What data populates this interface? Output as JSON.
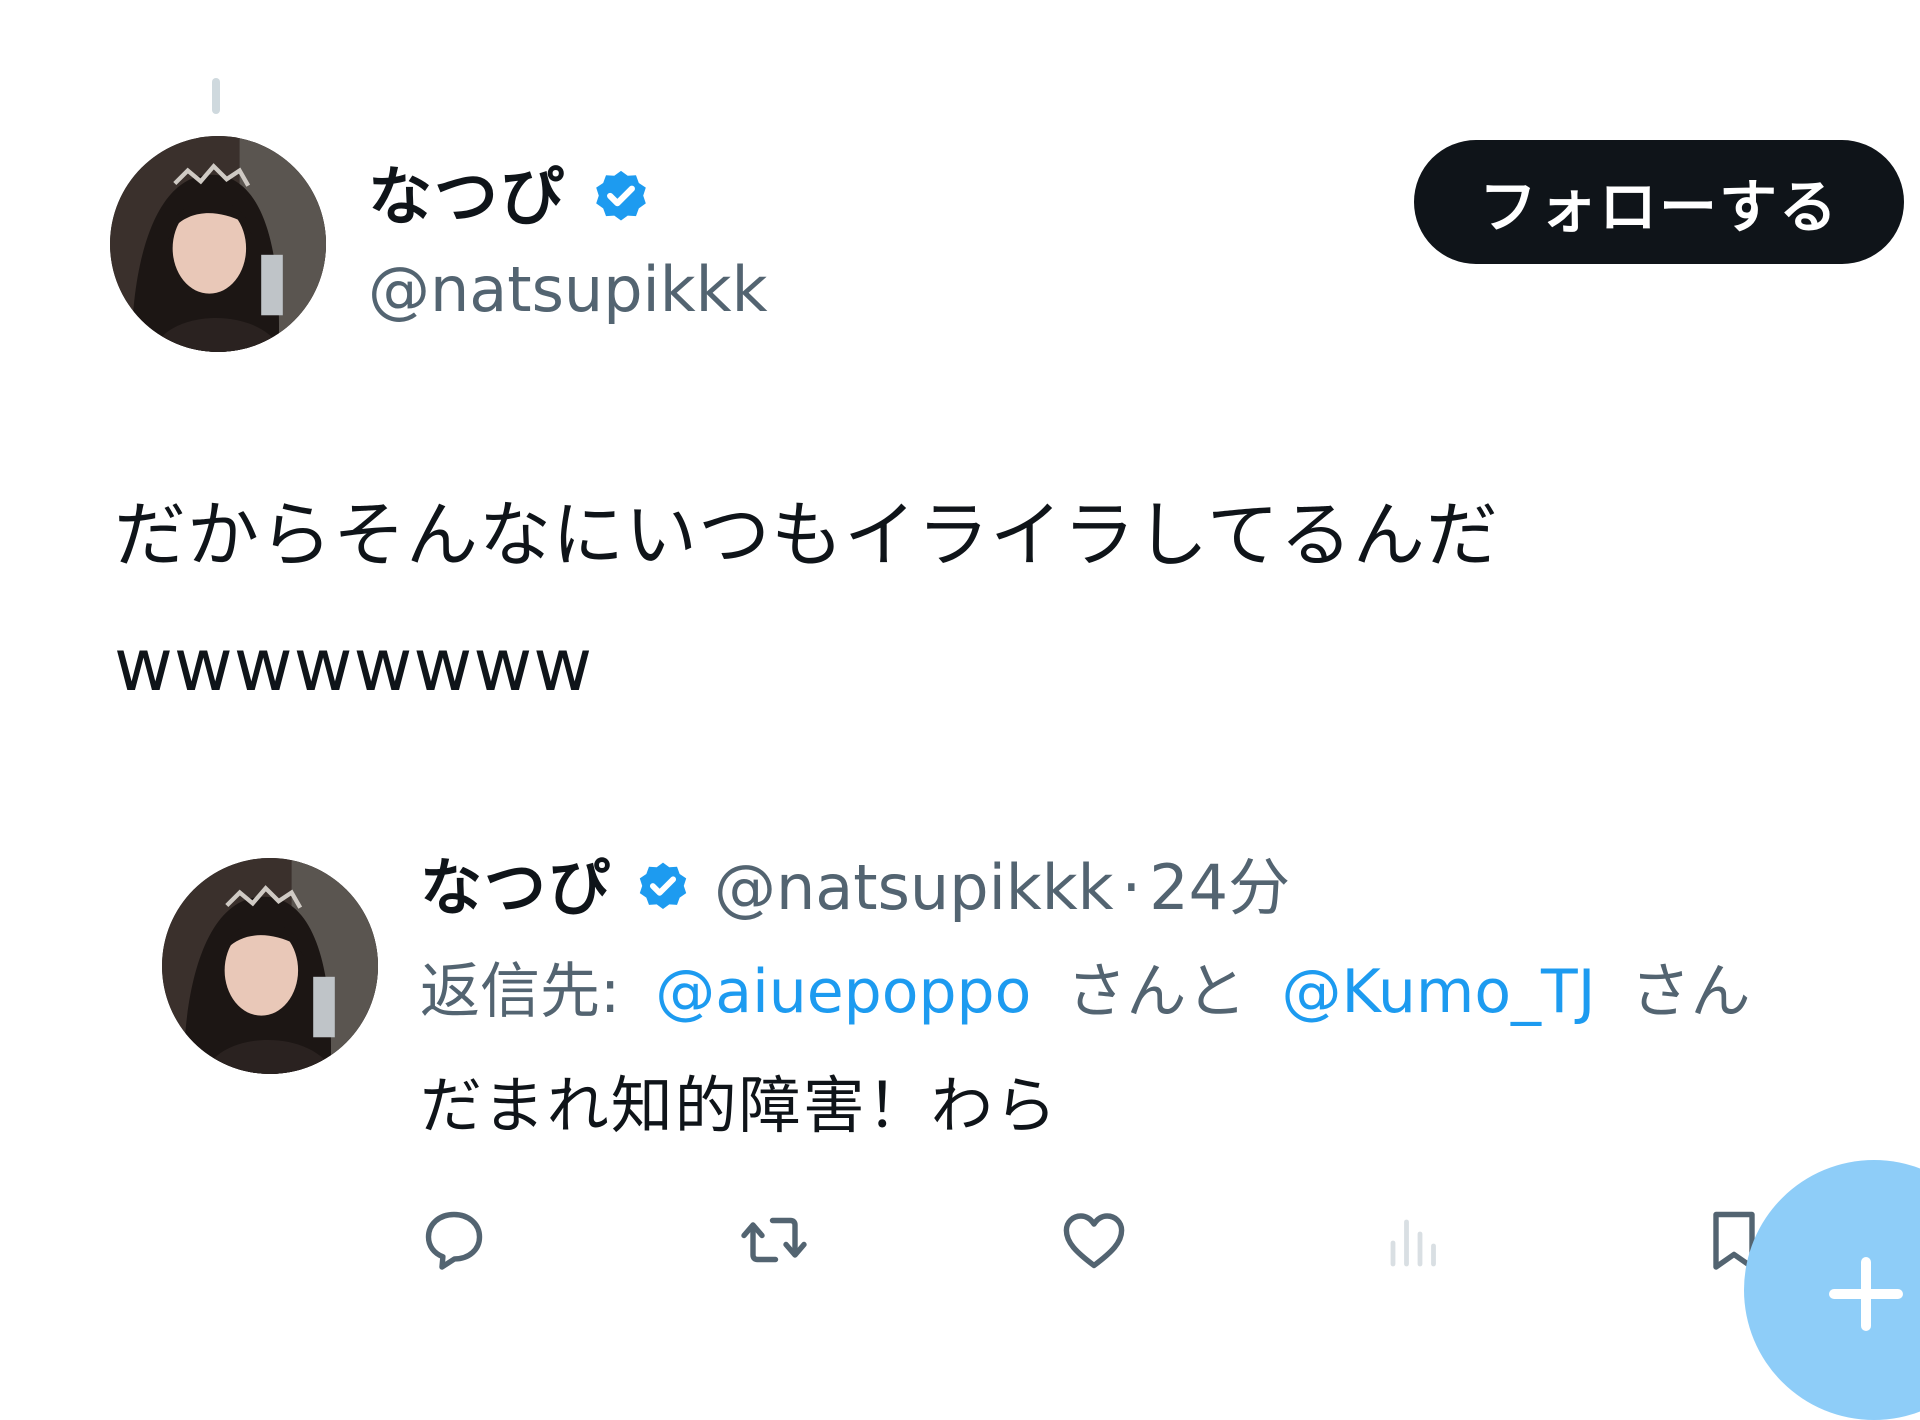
{
  "colors": {
    "accent": "#1d9bf0",
    "text": "#0f1419",
    "secondary": "#536471",
    "follow_button_bg": "#0f1419",
    "fab": "#8ecdf8"
  },
  "tweet": {
    "display_name": "なつぴ",
    "handle": "@natsupikkk",
    "verified_icon": "verified-badge-icon",
    "follow_button_label": "フォローする",
    "text_line1": "だからそんなにいつもイライラしてるんだ",
    "text_line2": "wwwwwwww"
  },
  "reply": {
    "display_name": "なつぴ",
    "handle": "@natsupikkk",
    "separator": "·",
    "time": "24分",
    "replying_to_label": "返信先:",
    "mention_1": "@aiuepoppo",
    "connector_1": "さんと",
    "mention_2": "@Kumo_TJ",
    "connector_2": "さん",
    "text": "だまれ知的障害！わら"
  },
  "actions": [
    {
      "icon": "reply-icon"
    },
    {
      "icon": "retweet-icon"
    },
    {
      "icon": "like-heart-icon"
    },
    {
      "icon": "views-analytics-icon"
    },
    {
      "icon": "bookmark-icon"
    }
  ],
  "compose": {
    "icon": "compose-plus-icon"
  }
}
